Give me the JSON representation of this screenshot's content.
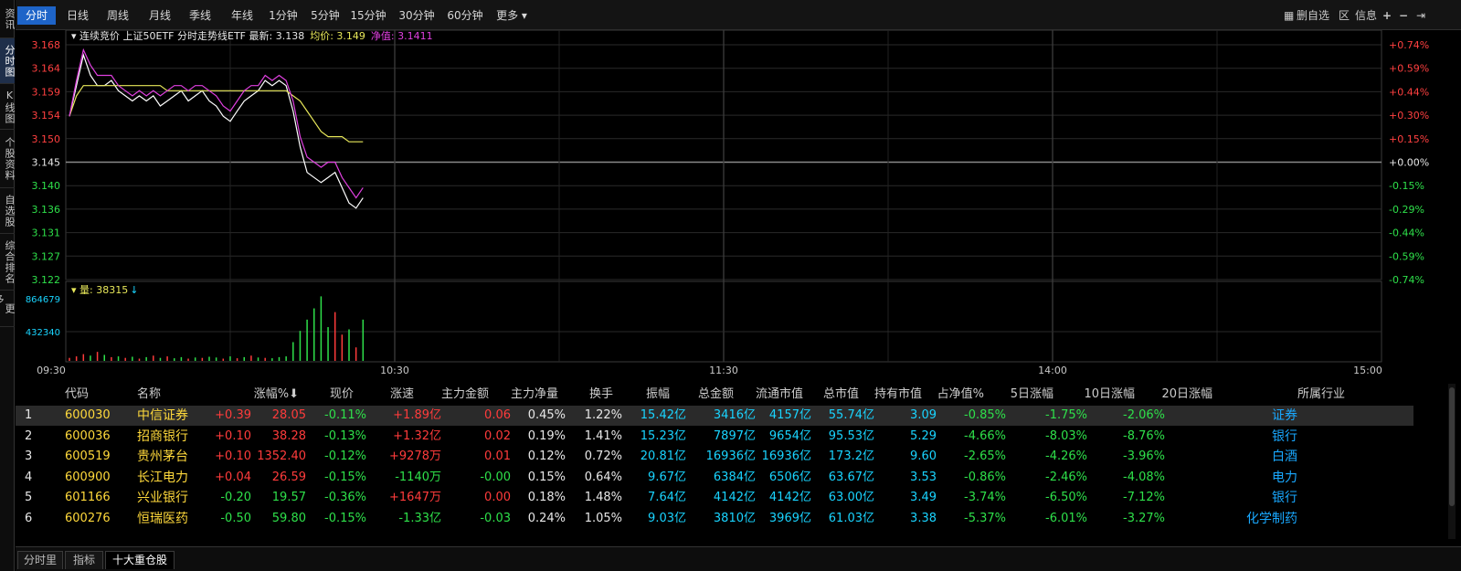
{
  "sidebar": {
    "items": [
      {
        "label": "资讯",
        "active": false
      },
      {
        "label": "分时图",
        "active": true
      },
      {
        "label": "K线图",
        "active": false
      },
      {
        "label": "个股资料",
        "active": false
      },
      {
        "label": "自选股",
        "active": false
      },
      {
        "label": "综合排名",
        "active": false
      },
      {
        "label": "更多..",
        "active": false
      }
    ]
  },
  "toolbar": {
    "periods": [
      "分时",
      "日线",
      "周线",
      "月线",
      "季线",
      "年线",
      "1分钟",
      "5分钟",
      "15分钟",
      "30分钟",
      "60分钟",
      "更多"
    ],
    "active_period": "分时",
    "right": {
      "delete_fav": "删自选",
      "region": "区",
      "info": "信息",
      "plus": "+",
      "minus": "−"
    }
  },
  "chart": {
    "header": {
      "prefix": "连续竞价 上证50ETF 分时走势线ETF 最新: 3.138",
      "avg_label": "均价: 3.149",
      "nav_label": "净值: 3.1411"
    },
    "price_ticks": [
      "3.168",
      "3.164",
      "3.159",
      "3.154",
      "3.150",
      "3.145",
      "3.140",
      "3.136",
      "3.131",
      "3.127",
      "3.122"
    ],
    "pct_ticks": [
      "+0.74%",
      "+0.59%",
      "+0.44%",
      "+0.30%",
      "+0.15%",
      "+0.00%",
      "-0.15%",
      "-0.29%",
      "-0.44%",
      "-0.59%",
      "-0.74%"
    ],
    "volume_header": "量: 38315",
    "volume_ticks": [
      "864679",
      "432340"
    ],
    "time_ticks": [
      "09:30",
      "10:30",
      "11:30",
      "14:00",
      "15:00"
    ],
    "colors": {
      "up": "#ff3b3b",
      "down": "#2ee04a",
      "avg": "#e8e85a",
      "nav": "#e040e0",
      "price": "#ffffff"
    }
  },
  "chart_data": {
    "type": "line",
    "xlabel": "",
    "ylabel": "",
    "ylim": [
      3.122,
      3.168
    ],
    "series": [
      {
        "name": "最新",
        "values": [
          3.154,
          3.16,
          3.166,
          3.162,
          3.16,
          3.16,
          3.161,
          3.159,
          3.158,
          3.157,
          3.158,
          3.157,
          3.158,
          3.156,
          3.157,
          3.158,
          3.159,
          3.157,
          3.158,
          3.159,
          3.157,
          3.156,
          3.154,
          3.153,
          3.155,
          3.157,
          3.158,
          3.159,
          3.161,
          3.16,
          3.161,
          3.16,
          3.155,
          3.148,
          3.143,
          3.142,
          3.141,
          3.142,
          3.143,
          3.14,
          3.137,
          3.136,
          3.138
        ]
      },
      {
        "name": "均价",
        "values": [
          3.154,
          3.158,
          3.16,
          3.16,
          3.16,
          3.16,
          3.16,
          3.16,
          3.16,
          3.16,
          3.16,
          3.16,
          3.16,
          3.16,
          3.159,
          3.159,
          3.159,
          3.159,
          3.159,
          3.159,
          3.159,
          3.159,
          3.159,
          3.159,
          3.159,
          3.159,
          3.159,
          3.159,
          3.159,
          3.159,
          3.159,
          3.159,
          3.158,
          3.157,
          3.155,
          3.153,
          3.151,
          3.15,
          3.15,
          3.15,
          3.149,
          3.149,
          3.149
        ]
      },
      {
        "name": "净值",
        "values": [
          3.154,
          3.161,
          3.167,
          3.164,
          3.162,
          3.162,
          3.162,
          3.16,
          3.159,
          3.158,
          3.159,
          3.158,
          3.159,
          3.158,
          3.159,
          3.16,
          3.16,
          3.159,
          3.16,
          3.16,
          3.159,
          3.158,
          3.156,
          3.155,
          3.157,
          3.159,
          3.16,
          3.16,
          3.162,
          3.161,
          3.162,
          3.161,
          3.157,
          3.15,
          3.146,
          3.145,
          3.144,
          3.145,
          3.145,
          3.142,
          3.14,
          3.138,
          3.14
        ]
      }
    ],
    "volume": [
      {
        "v": 40000,
        "c": "up"
      },
      {
        "v": 60000,
        "c": "up"
      },
      {
        "v": 90000,
        "c": "up"
      },
      {
        "v": 70000,
        "c": "down"
      },
      {
        "v": 120000,
        "c": "up"
      },
      {
        "v": 80000,
        "c": "down"
      },
      {
        "v": 50000,
        "c": "up"
      },
      {
        "v": 60000,
        "c": "down"
      },
      {
        "v": 40000,
        "c": "up"
      },
      {
        "v": 55000,
        "c": "down"
      },
      {
        "v": 30000,
        "c": "up"
      },
      {
        "v": 50000,
        "c": "down"
      },
      {
        "v": 70000,
        "c": "up"
      },
      {
        "v": 40000,
        "c": "down"
      },
      {
        "v": 60000,
        "c": "up"
      },
      {
        "v": 35000,
        "c": "down"
      },
      {
        "v": 50000,
        "c": "down"
      },
      {
        "v": 30000,
        "c": "up"
      },
      {
        "v": 45000,
        "c": "down"
      },
      {
        "v": 40000,
        "c": "up"
      },
      {
        "v": 55000,
        "c": "down"
      },
      {
        "v": 45000,
        "c": "down"
      },
      {
        "v": 30000,
        "c": "up"
      },
      {
        "v": 60000,
        "c": "down"
      },
      {
        "v": 35000,
        "c": "up"
      },
      {
        "v": 50000,
        "c": "down"
      },
      {
        "v": 70000,
        "c": "up"
      },
      {
        "v": 45000,
        "c": "down"
      },
      {
        "v": 40000,
        "c": "up"
      },
      {
        "v": 35000,
        "c": "down"
      },
      {
        "v": 50000,
        "c": "down"
      },
      {
        "v": 60000,
        "c": "down"
      },
      {
        "v": 250000,
        "c": "down"
      },
      {
        "v": 400000,
        "c": "down"
      },
      {
        "v": 550000,
        "c": "down"
      },
      {
        "v": 700000,
        "c": "down"
      },
      {
        "v": 860000,
        "c": "down"
      },
      {
        "v": 450000,
        "c": "down"
      },
      {
        "v": 650000,
        "c": "up"
      },
      {
        "v": 350000,
        "c": "up"
      },
      {
        "v": 420000,
        "c": "down"
      },
      {
        "v": 180000,
        "c": "up"
      },
      {
        "v": 550000,
        "c": "down"
      }
    ]
  },
  "table": {
    "headers": [
      "代码",
      "名称",
      "涨幅%",
      "现价",
      "涨速",
      "主力金额",
      "主力净量",
      "换手",
      "振幅",
      "总金额",
      "流通市值",
      "总市值",
      "持有市值",
      "占净值%",
      "5日涨幅",
      "10日涨幅",
      "20日涨幅",
      "所属行业"
    ],
    "rows": [
      {
        "idx": "1",
        "code": "600030",
        "name": "中信证券",
        "chg": "+0.39",
        "price": "28.05",
        "speed": "-0.11%",
        "main_amt": "+1.89亿",
        "main_net": "0.06",
        "turnover": "0.45%",
        "amplitude": "1.22%",
        "total_amt": "15.42亿",
        "float_cap": "3416亿",
        "total_cap": "4157亿",
        "hold_cap": "55.74亿",
        "nav_pct": "3.09",
        "d5": "-0.85%",
        "d10": "-1.75%",
        "d20": "-2.06%",
        "industry": "证券"
      },
      {
        "idx": "2",
        "code": "600036",
        "name": "招商银行",
        "chg": "+0.10",
        "price": "38.28",
        "speed": "-0.13%",
        "main_amt": "+1.32亿",
        "main_net": "0.02",
        "turnover": "0.19%",
        "amplitude": "1.41%",
        "total_amt": "15.23亿",
        "float_cap": "7897亿",
        "total_cap": "9654亿",
        "hold_cap": "95.53亿",
        "nav_pct": "5.29",
        "d5": "-4.66%",
        "d10": "-8.03%",
        "d20": "-8.76%",
        "industry": "银行"
      },
      {
        "idx": "3",
        "code": "600519",
        "name": "贵州茅台",
        "chg": "+0.10",
        "price": "1352.40",
        "speed": "-0.12%",
        "main_amt": "+9278万",
        "main_net": "0.01",
        "turnover": "0.12%",
        "amplitude": "0.72%",
        "total_amt": "20.81亿",
        "float_cap": "16936亿",
        "total_cap": "16936亿",
        "hold_cap": "173.2亿",
        "nav_pct": "9.60",
        "d5": "-2.65%",
        "d10": "-4.26%",
        "d20": "-3.96%",
        "industry": "白酒"
      },
      {
        "idx": "4",
        "code": "600900",
        "name": "长江电力",
        "chg": "+0.04",
        "price": "26.59",
        "speed": "-0.15%",
        "main_amt": "-1140万",
        "main_net": "-0.00",
        "turnover": "0.15%",
        "amplitude": "0.64%",
        "total_amt": "9.67亿",
        "float_cap": "6384亿",
        "total_cap": "6506亿",
        "hold_cap": "63.67亿",
        "nav_pct": "3.53",
        "d5": "-0.86%",
        "d10": "-2.46%",
        "d20": "-4.08%",
        "industry": "电力"
      },
      {
        "idx": "5",
        "code": "601166",
        "name": "兴业银行",
        "chg": "-0.20",
        "price": "19.57",
        "speed": "-0.36%",
        "main_amt": "+1647万",
        "main_net": "0.00",
        "turnover": "0.18%",
        "amplitude": "1.48%",
        "total_amt": "7.64亿",
        "float_cap": "4142亿",
        "total_cap": "4142亿",
        "hold_cap": "63.00亿",
        "nav_pct": "3.49",
        "d5": "-3.74%",
        "d10": "-6.50%",
        "d20": "-7.12%",
        "industry": "银行"
      },
      {
        "idx": "6",
        "code": "600276",
        "name": "恒瑞医药",
        "chg": "-0.50",
        "price": "59.80",
        "speed": "-0.15%",
        "main_amt": "-1.33亿",
        "main_net": "-0.03",
        "turnover": "0.24%",
        "amplitude": "1.05%",
        "total_amt": "9.03亿",
        "float_cap": "3810亿",
        "total_cap": "3969亿",
        "hold_cap": "61.03亿",
        "nav_pct": "3.38",
        "d5": "-5.37%",
        "d10": "-6.01%",
        "d20": "-3.27%",
        "industry": "化学制药"
      }
    ]
  },
  "bottom_tabs": {
    "items": [
      {
        "label": "分时里",
        "active": false
      },
      {
        "label": "指标",
        "active": false
      },
      {
        "label": "十大重仓股",
        "active": true
      }
    ]
  }
}
